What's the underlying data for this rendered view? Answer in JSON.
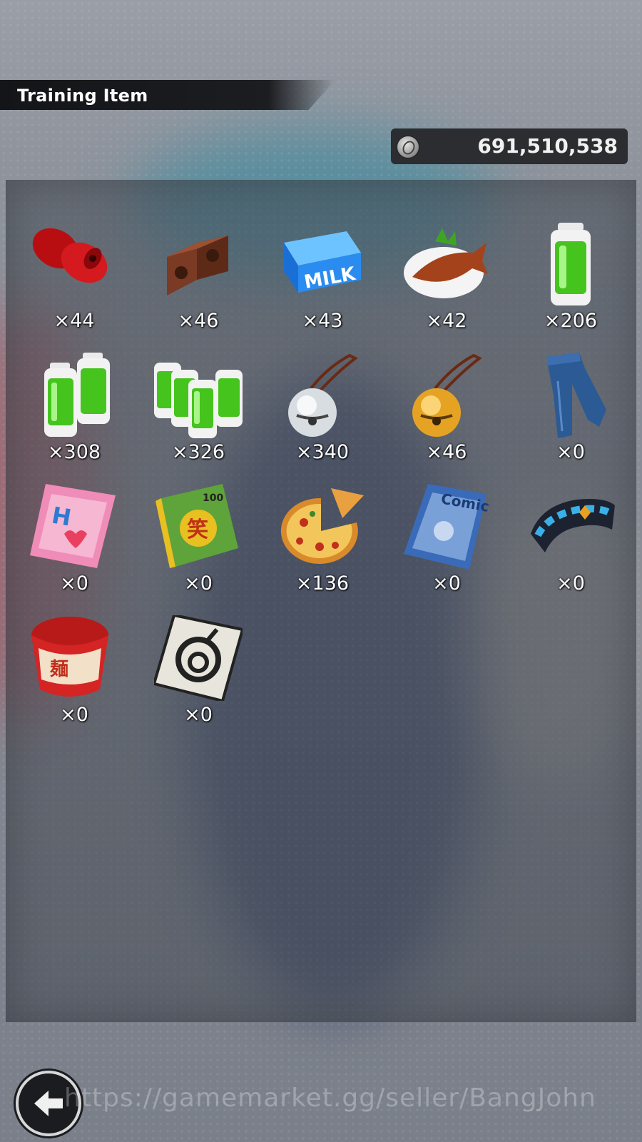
{
  "header": {
    "title": "Training Item"
  },
  "currency": {
    "icon": "zeni-coin-icon",
    "amount": "691,510,538"
  },
  "items": [
    {
      "name": "weight-icon",
      "count": "×44"
    },
    {
      "name": "brick-icon",
      "count": "×46"
    },
    {
      "name": "milk-carton-icon",
      "count": "×43"
    },
    {
      "name": "grilled-fish-icon",
      "count": "×42"
    },
    {
      "name": "battery-single-icon",
      "count": "×206"
    },
    {
      "name": "battery-double-icon",
      "count": "×308"
    },
    {
      "name": "battery-pack-icon",
      "count": "×326"
    },
    {
      "name": "silver-bell-icon",
      "count": "×340"
    },
    {
      "name": "gold-bell-icon",
      "count": "×46"
    },
    {
      "name": "jeans-icon",
      "count": "×0"
    },
    {
      "name": "pink-magazine-icon",
      "count": "×0"
    },
    {
      "name": "joke-book-icon",
      "count": "×0"
    },
    {
      "name": "pizza-icon",
      "count": "×136"
    },
    {
      "name": "comic-book-icon",
      "count": "×0"
    },
    {
      "name": "wristband-icon",
      "count": "×0"
    },
    {
      "name": "ramen-cup-icon",
      "count": "×0"
    },
    {
      "name": "capsule-card-icon",
      "count": "×0"
    }
  ],
  "footer": {
    "back_icon": "back-arrow-icon",
    "watermark": "https://gamemarket.gg/seller/BangJohn"
  }
}
